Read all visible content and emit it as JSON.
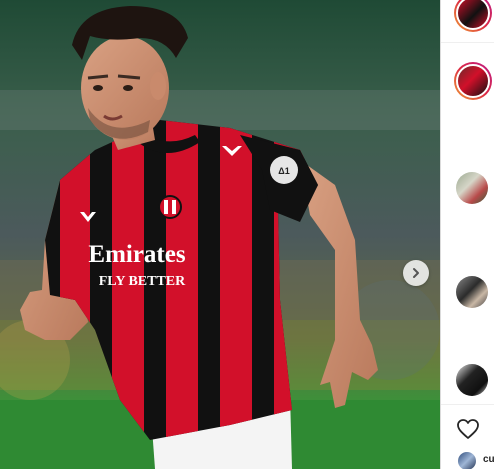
{
  "post": {
    "jersey_text_line1": "Emirates",
    "jersey_text_line2": "FLY BETTER",
    "next_button_icon": "chevron-right-icon"
  },
  "sidebar": {
    "avatars": [
      {
        "name": "avatar-1"
      },
      {
        "name": "avatar-2"
      },
      {
        "name": "avatar-3"
      },
      {
        "name": "avatar-4"
      },
      {
        "name": "avatar-5"
      }
    ],
    "like_icon": "heart-icon",
    "footer_username": "cu"
  },
  "colors": {
    "milan_red": "#d2102a",
    "milan_black": "#111111",
    "pitch_green": "#3f8f3a",
    "ig_gradient": "#dc2743"
  }
}
